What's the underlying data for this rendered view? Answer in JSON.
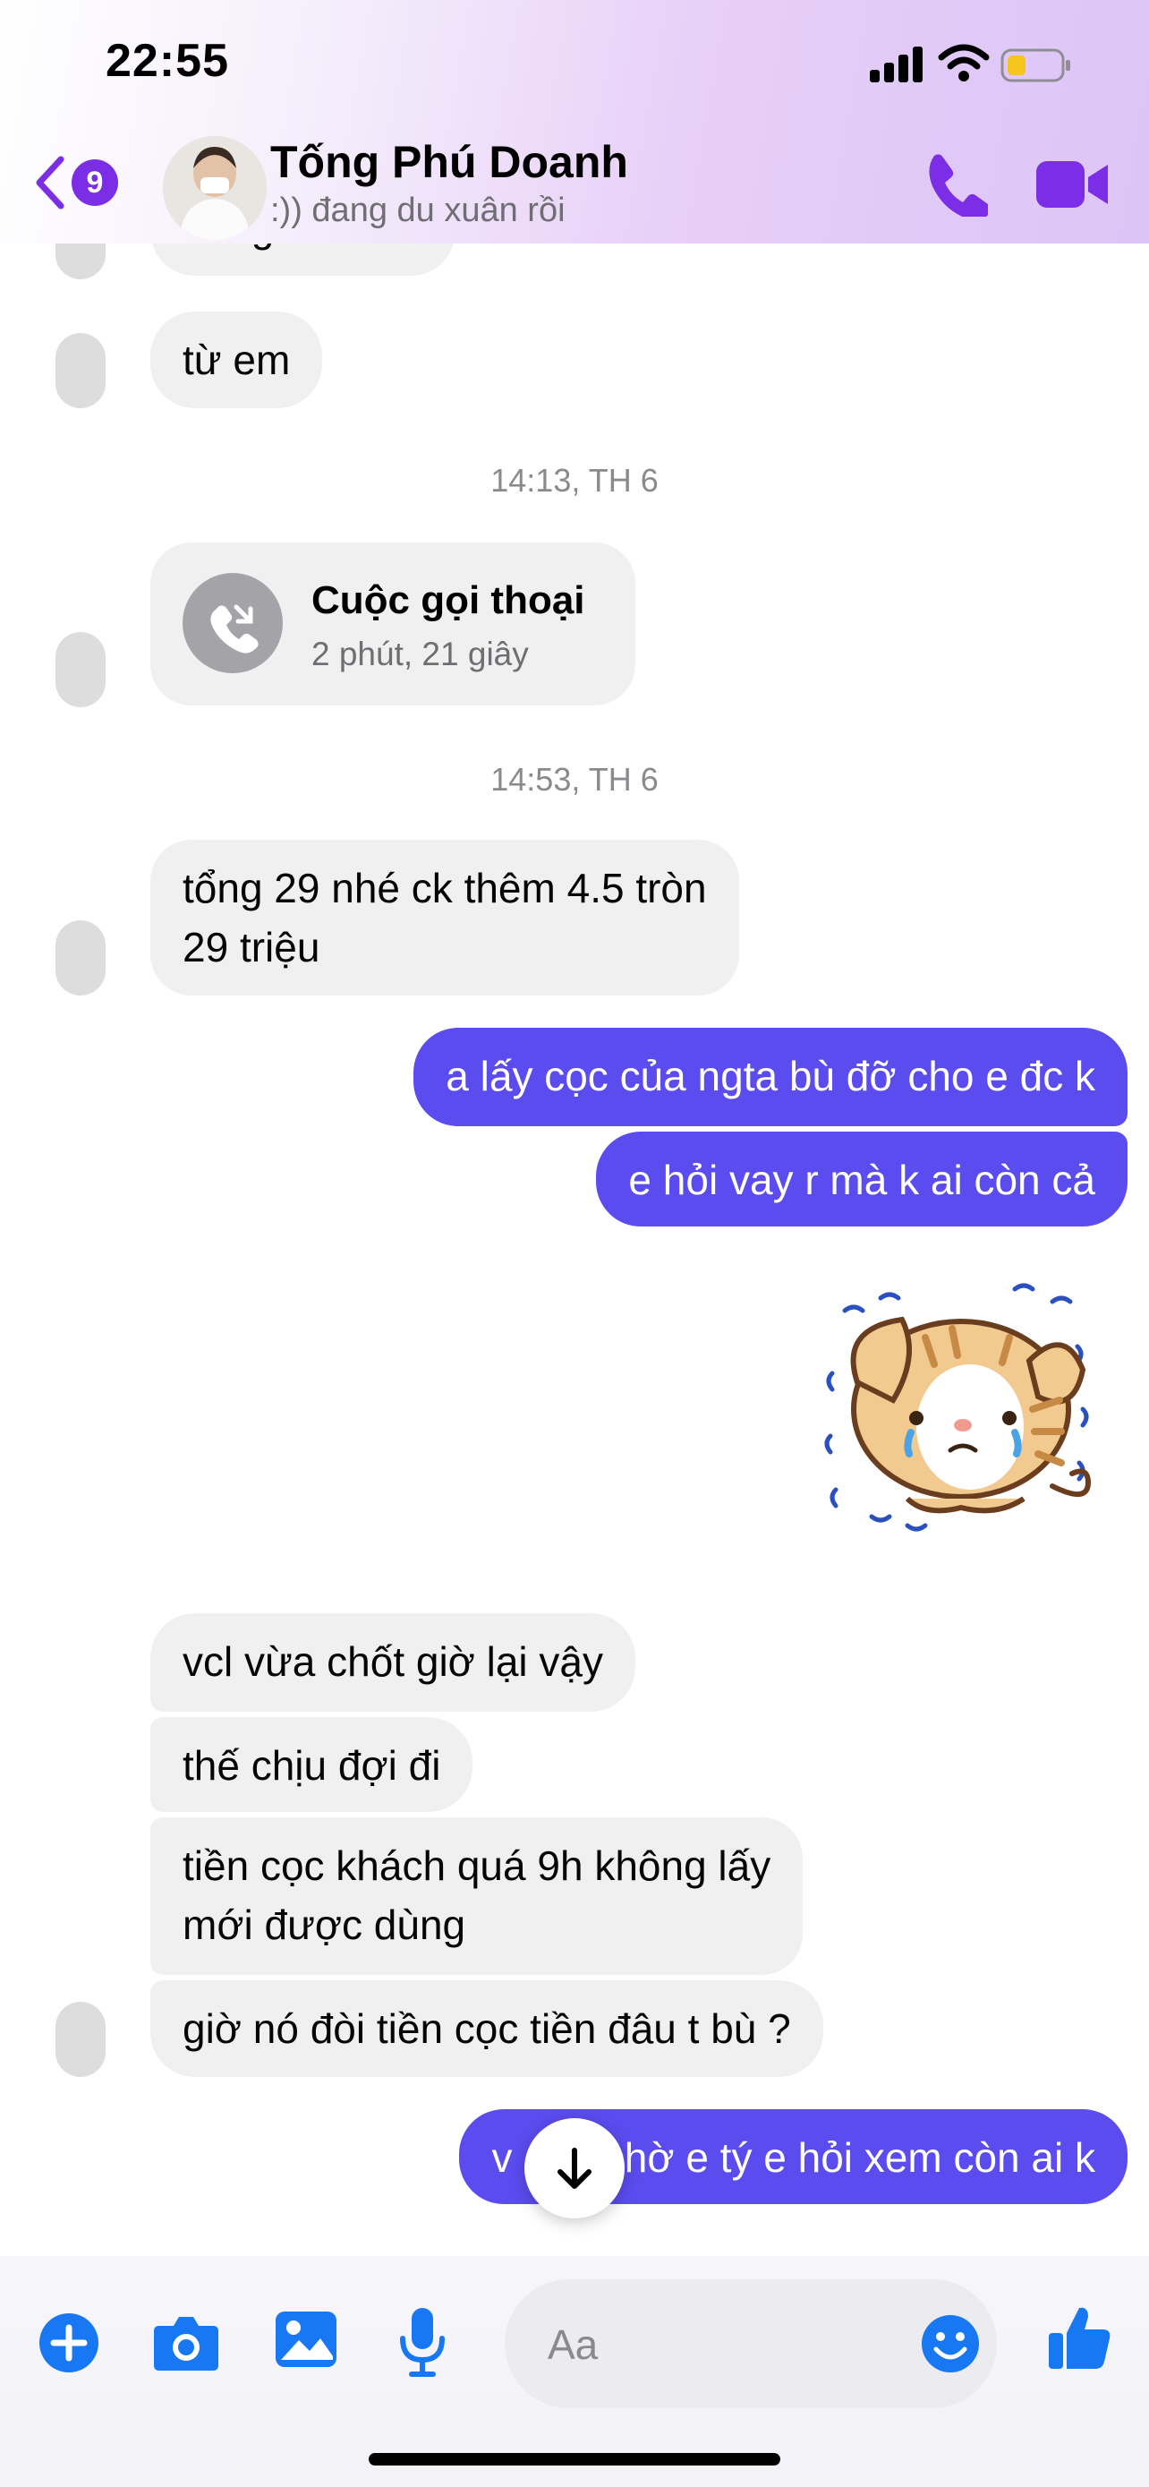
{
  "status_bar": {
    "time": "22:55"
  },
  "header": {
    "back_badge": "9",
    "contact_name": "Tống Phú Doanh",
    "contact_status": ":)) đang du xuân rồi"
  },
  "messages": {
    "partial_top": "đangu rồi em",
    "m1": "từ em",
    "ts1": "14:13, TH 6",
    "call_title": "Cuộc gọi thoại",
    "call_duration": "2 phút, 21 giây",
    "ts2": "14:53, TH 6",
    "m2_line1": "tổng 29 nhé ck thêm 4.5 tròn",
    "m2_line2": "29 triệu",
    "out1": "a lấy cọc của ngta bù đỡ cho e đc k",
    "out2": "e hỏi vay r mà k ai còn cả",
    "m3": "vcl vừa chốt giờ lại vậy",
    "m4": "thế chịu đợi đi",
    "m5_line1": "tiền cọc khách quá 9h không lấy",
    "m5_line2": "mới được dùng",
    "m6": "giờ nó đòi tiền cọc tiền đâu t bù ?",
    "out3": "v anh chờ e tý e hỏi xem còn ai k"
  },
  "composer": {
    "placeholder": "Aa"
  },
  "colors": {
    "accent": "#7b2ee6",
    "outgoing": "#5b4cf0",
    "like_blue": "#1877f2"
  }
}
